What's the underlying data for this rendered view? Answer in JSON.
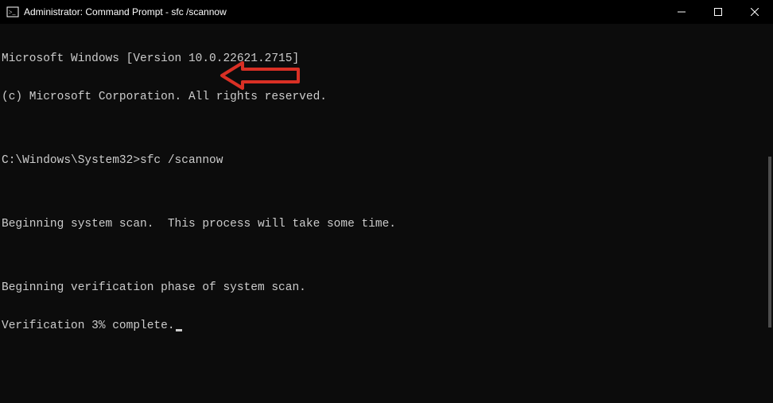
{
  "titlebar": {
    "title": "Administrator: Command Prompt - sfc  /scannow"
  },
  "terminal": {
    "line1": "Microsoft Windows [Version 10.0.22621.2715]",
    "line2": "(c) Microsoft Corporation. All rights reserved.",
    "blank1": "",
    "prompt": "C:\\Windows\\System32>",
    "command": "sfc /scannow",
    "blank2": "",
    "line3": "Beginning system scan.  This process will take some time.",
    "blank3": "",
    "line4": "Beginning verification phase of system scan.",
    "line5": "Verification 3% complete."
  },
  "annotation": {
    "arrow_color": "#d93025"
  },
  "scrollbar": {
    "thumb_top_pct": 35,
    "thumb_height_pct": 45
  }
}
